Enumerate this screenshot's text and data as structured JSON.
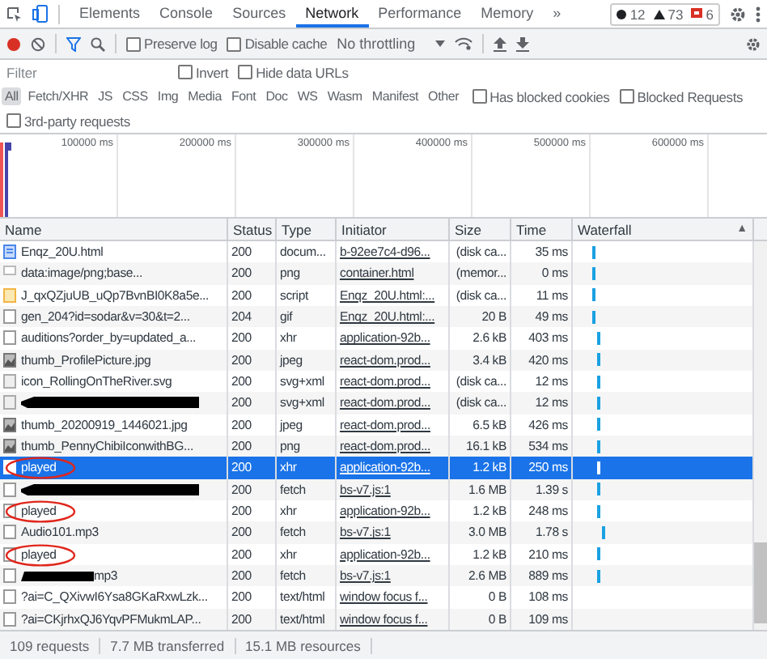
{
  "tabs": [
    {
      "label": "Elements",
      "selected": false
    },
    {
      "label": "Console",
      "selected": false
    },
    {
      "label": "Sources",
      "selected": false
    },
    {
      "label": "Network",
      "selected": true
    },
    {
      "label": "Performance",
      "selected": false
    },
    {
      "label": "Memory",
      "selected": false
    }
  ],
  "more_tabs": "»",
  "badges": [
    {
      "kind": "error",
      "count": "12"
    },
    {
      "kind": "warning",
      "count": "73"
    },
    {
      "kind": "issue",
      "count": "6"
    }
  ],
  "toolbar": {
    "checkboxes": [
      {
        "label": "Preserve log",
        "checked": false
      },
      {
        "label": "Disable cache",
        "checked": false
      }
    ],
    "throttling": "No throttling"
  },
  "filter": {
    "placeholder": "Filter",
    "checkboxes": [
      {
        "label": "Invert",
        "checked": false
      },
      {
        "label": "Hide data URLs",
        "checked": false
      }
    ]
  },
  "type_filters": [
    {
      "label": "All",
      "selected": true
    },
    {
      "label": "Fetch/XHR",
      "selected": false
    },
    {
      "label": "JS",
      "selected": false
    },
    {
      "label": "CSS",
      "selected": false
    },
    {
      "label": "Img",
      "selected": false
    },
    {
      "label": "Media",
      "selected": false
    },
    {
      "label": "Font",
      "selected": false
    },
    {
      "label": "Doc",
      "selected": false
    },
    {
      "label": "WS",
      "selected": false
    },
    {
      "label": "Wasm",
      "selected": false
    },
    {
      "label": "Manifest",
      "selected": false
    },
    {
      "label": "Other",
      "selected": false
    }
  ],
  "type_checkboxes": [
    {
      "label": "Has blocked cookies",
      "checked": false
    },
    {
      "label": "Blocked Requests",
      "checked": false
    }
  ],
  "third_party": {
    "label": "3rd-party requests",
    "checked": false
  },
  "overview_ticks": [
    "100000 ms",
    "200000 ms",
    "300000 ms",
    "400000 ms",
    "500000 ms",
    "600000 ms"
  ],
  "columns": [
    "Name",
    "Status",
    "Type",
    "Initiator",
    "Size",
    "Time",
    "Waterfall"
  ],
  "sort_indicator": "▲",
  "rows": [
    {
      "kind": "doc",
      "name": "Enqz_20U.html",
      "status": "200",
      "type": "docum...",
      "initiator": "b-92ee7c4-d96...",
      "size": "(disk ca...",
      "time": "35 ms",
      "waterfall": true,
      "selected": false
    },
    {
      "kind": "blank",
      "name": "data:image/png;base...",
      "status": "200",
      "type": "png",
      "initiator": "container.html",
      "size": "(memor...",
      "time": "0 ms",
      "waterfall": true,
      "selected": false
    },
    {
      "kind": "script",
      "name": "J_qxQZjuUB_uQp7BvnBI0K8a5e...",
      "status": "200",
      "type": "script",
      "initiator": "Enqz_20U.html:...",
      "size": "(disk ca...",
      "time": "11 ms",
      "waterfall": true,
      "selected": false
    },
    {
      "kind": "file",
      "name": "gen_204?id=sodar&v=30&t=2...",
      "status": "204",
      "type": "gif",
      "initiator": "Enqz_20U.html:...",
      "size": "20 B",
      "time": "49 ms",
      "waterfall": true,
      "selected": false
    },
    {
      "kind": "file",
      "name": "auditions?order_by=updated_a...",
      "status": "200",
      "type": "xhr",
      "initiator": "application-92b...",
      "size": "2.6 kB",
      "time": "403 ms",
      "waterfall": true,
      "selected": false
    },
    {
      "kind": "image",
      "name": "thumb_ProfilePicture.jpg",
      "status": "200",
      "type": "jpeg",
      "initiator": "react-dom.prod...",
      "size": "3.4 kB",
      "time": "420 ms",
      "waterfall": true,
      "selected": false
    },
    {
      "kind": "svg",
      "name": "icon_RollingOnTheRiver.svg",
      "status": "200",
      "type": "svg+xml",
      "initiator": "react-dom.prod...",
      "size": "(disk ca...",
      "time": "12 ms",
      "waterfall": true,
      "selected": false
    },
    {
      "kind": "svg",
      "redacted": true,
      "status": "200",
      "type": "svg+xml",
      "initiator": "react-dom.prod...",
      "size": "(disk ca...",
      "time": "12 ms",
      "waterfall": true,
      "selected": false
    },
    {
      "kind": "image",
      "name": "thumb_20200919_1446021.jpg",
      "status": "200",
      "type": "jpeg",
      "initiator": "react-dom.prod...",
      "size": "6.5 kB",
      "time": "426 ms",
      "waterfall": true,
      "selected": false
    },
    {
      "kind": "image",
      "name": "thumb_PennyChibiIconwithBG...",
      "status": "200",
      "type": "png",
      "initiator": "react-dom.prod...",
      "size": "16.1 kB",
      "time": "534 ms",
      "waterfall": true,
      "selected": false
    },
    {
      "kind": "file",
      "name": "played",
      "circled": true,
      "status": "200",
      "type": "xhr",
      "initiator": "application-92b...",
      "size": "1.2 kB",
      "time": "250 ms",
      "waterfall": true,
      "selected": true
    },
    {
      "kind": "file",
      "redacted": true,
      "status": "200",
      "type": "fetch",
      "initiator": "bs-v7.js:1",
      "size": "1.6 MB",
      "time": "1.39 s",
      "waterfall": true,
      "selected": false
    },
    {
      "kind": "file",
      "name": "played",
      "circled": true,
      "status": "200",
      "type": "xhr",
      "initiator": "application-92b...",
      "size": "1.2 kB",
      "time": "248 ms",
      "waterfall": true,
      "selected": false
    },
    {
      "kind": "file",
      "name": "Audio101.mp3",
      "status": "200",
      "type": "fetch",
      "initiator": "bs-v7.js:1",
      "size": "3.0 MB",
      "time": "1.78 s",
      "waterfall": true,
      "selected": false
    },
    {
      "kind": "file",
      "name": "played",
      "circled": true,
      "status": "200",
      "type": "xhr",
      "initiator": "application-92b...",
      "size": "1.2 kB",
      "time": "210 ms",
      "waterfall": true,
      "selected": false
    },
    {
      "kind": "file",
      "redacted": true,
      "name": "mp3",
      "status": "200",
      "type": "fetch",
      "initiator": "bs-v7.js:1",
      "size": "2.6 MB",
      "time": "889 ms",
      "waterfall": true,
      "selected": false
    },
    {
      "kind": "file",
      "name": "?ai=C_QXivwI6Ysa8GKaRxwLzk...",
      "status": "200",
      "type": "text/html",
      "initiator": "window focus f...",
      "size": "0 B",
      "time": "108 ms",
      "waterfall": false,
      "selected": false
    },
    {
      "kind": "file",
      "name": "?ai=CKjrhxQJ6YqvPFMukmLAP...",
      "status": "200",
      "type": "text/html",
      "initiator": "window focus f...",
      "size": "0 B",
      "time": "109 ms",
      "waterfall": false,
      "selected": false
    }
  ],
  "status_bar": [
    "109 requests",
    "7.7 MB transferred",
    "15.1 MB resources"
  ]
}
